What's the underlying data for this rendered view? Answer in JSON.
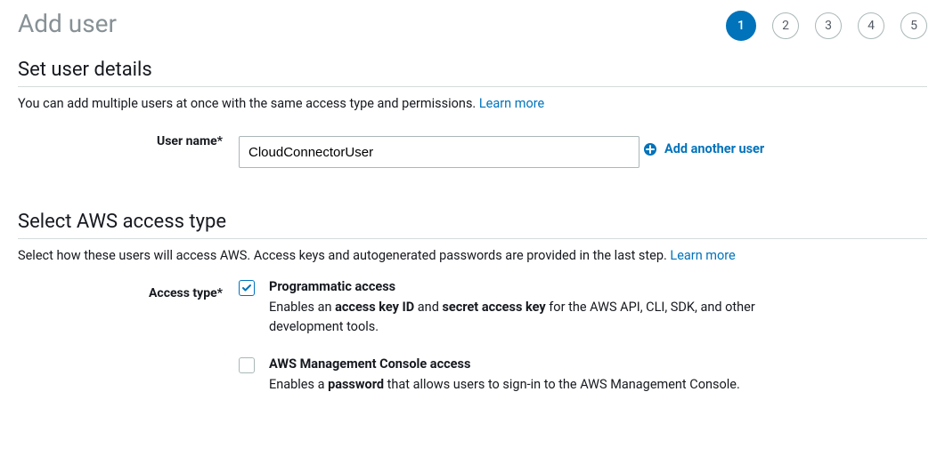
{
  "page": {
    "title": "Add user"
  },
  "steps": [
    "1",
    "2",
    "3",
    "4",
    "5"
  ],
  "activeStep": 0,
  "userDetails": {
    "heading": "Set user details",
    "helper": "You can add multiple users at once with the same access type and permissions. ",
    "learnMore": "Learn more",
    "userNameLabel": "User name*",
    "userNameValue": "CloudConnectorUser",
    "addAnother": "Add another user"
  },
  "accessType": {
    "heading": "Select AWS access type",
    "helper": "Select how these users will access AWS. Access keys and autogenerated passwords are provided in the last step. ",
    "learnMore": "Learn more",
    "label": "Access type*",
    "options": [
      {
        "checked": true,
        "title": "Programmatic access",
        "descPrefix": "Enables an ",
        "descBold1": "access key ID",
        "descMid": " and ",
        "descBold2": "secret access key",
        "descSuffix": " for the AWS API, CLI, SDK, and other development tools."
      },
      {
        "checked": false,
        "title": "AWS Management Console access",
        "descPrefix": "Enables a ",
        "descBold1": "password",
        "descMid": "",
        "descBold2": "",
        "descSuffix": " that allows users to sign-in to the AWS Management Console."
      }
    ]
  }
}
